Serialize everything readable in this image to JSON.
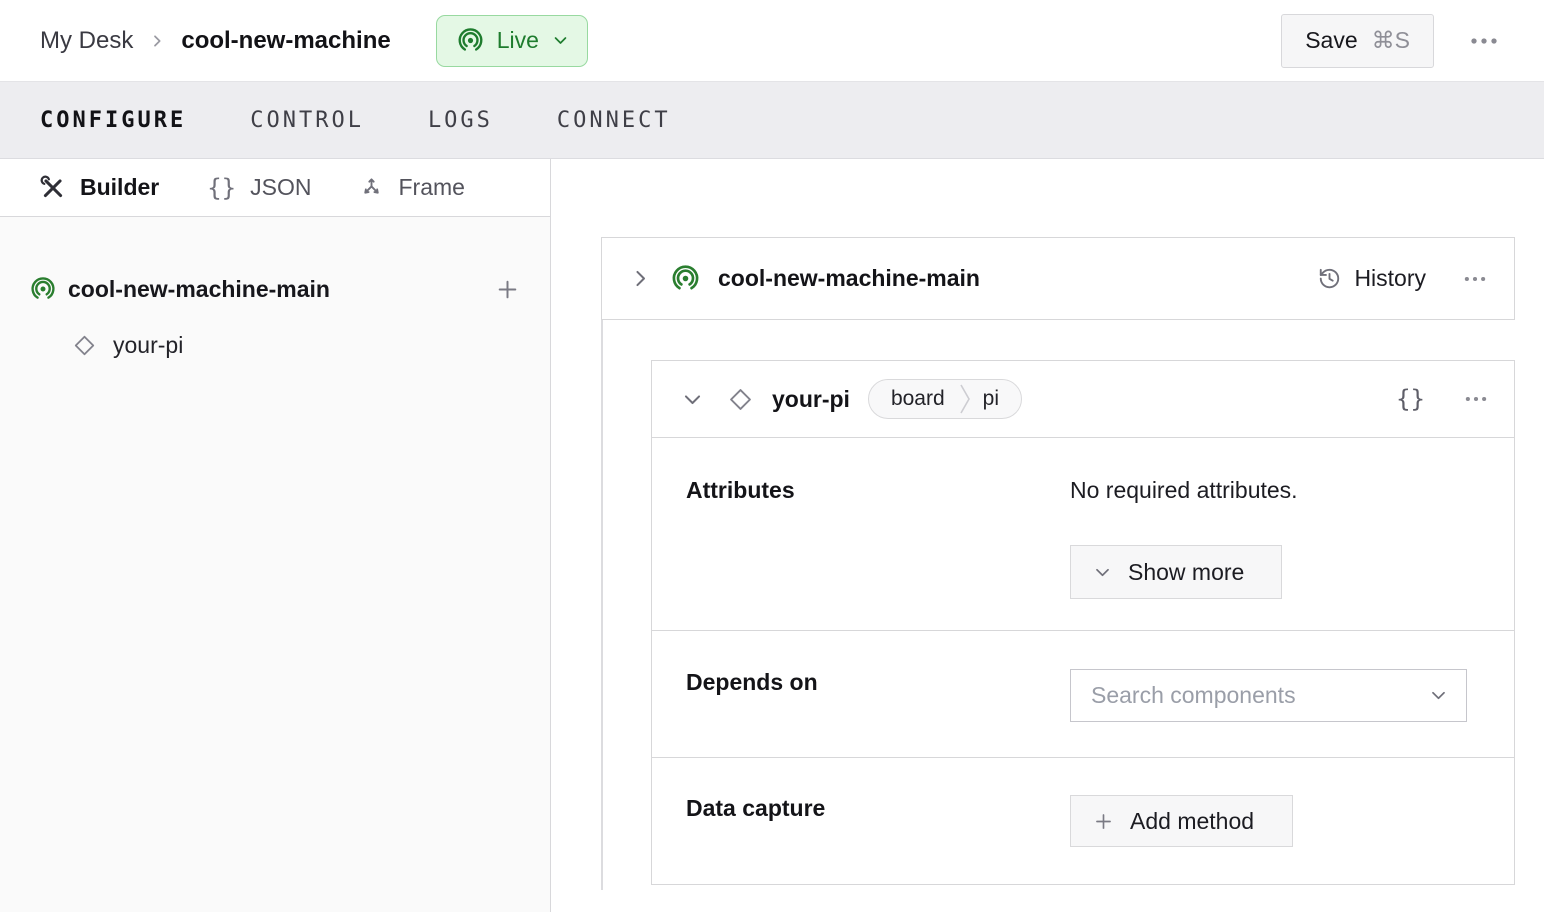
{
  "header": {
    "breadcrumb": {
      "parent": "My Desk",
      "current": "cool-new-machine"
    },
    "status": {
      "label": "Live"
    },
    "save": {
      "label": "Save",
      "shortcut": "⌘S"
    }
  },
  "tabs": [
    {
      "label": "CONFIGURE",
      "active": true
    },
    {
      "label": "CONTROL",
      "active": false
    },
    {
      "label": "LOGS",
      "active": false
    },
    {
      "label": "CONNECT",
      "active": false
    }
  ],
  "sidebar": {
    "views": [
      {
        "label": "Builder",
        "active": true
      },
      {
        "label": "JSON",
        "active": false
      },
      {
        "label": "Frame",
        "active": false
      }
    ],
    "tree": {
      "machine": {
        "label": "cool-new-machine-main"
      },
      "component": {
        "label": "your-pi"
      }
    }
  },
  "main": {
    "machine_card": {
      "title": "cool-new-machine-main",
      "history_label": "History"
    },
    "component_card": {
      "title": "your-pi",
      "type_badge": {
        "category": "board",
        "model": "pi"
      },
      "braces_glyph": "{}",
      "attributes": {
        "label": "Attributes",
        "empty_text": "No required attributes.",
        "show_more_label": "Show more"
      },
      "depends_on": {
        "label": "Depends on",
        "placeholder": "Search components"
      },
      "data_capture": {
        "label": "Data capture",
        "add_method_label": "Add method"
      }
    }
  },
  "colors": {
    "accent_green": "#2a7e2f",
    "live_badge_bg": "#e4f8e5",
    "live_badge_border": "#98d9a0",
    "live_badge_text": "#1e7c2e",
    "tabbar_bg": "#ededf0",
    "sidebar_bg": "#fafafa",
    "card_border": "#d7d7d9"
  }
}
